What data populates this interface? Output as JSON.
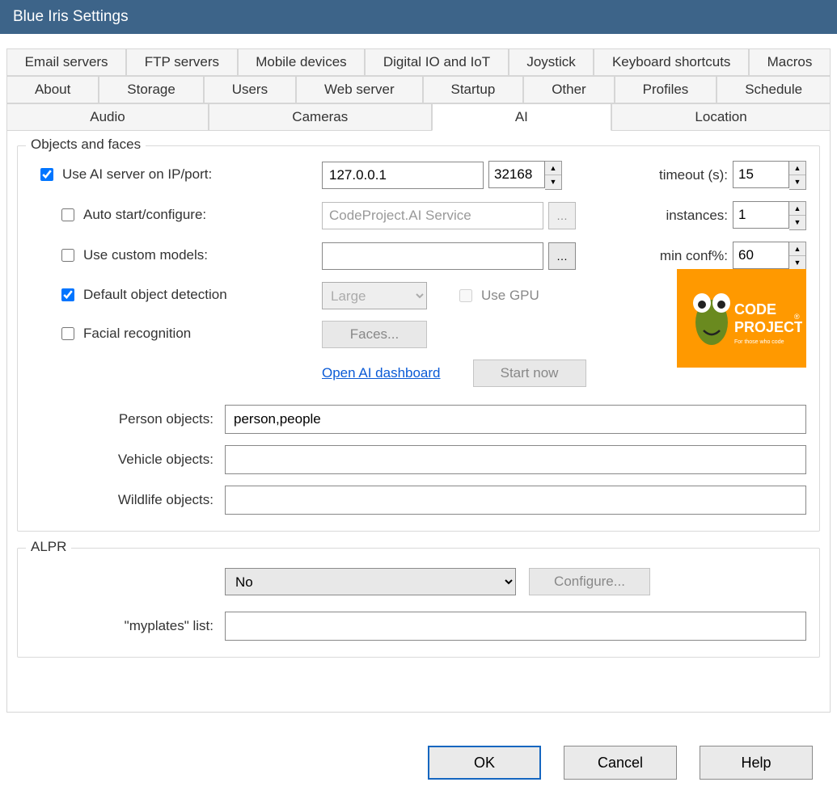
{
  "window": {
    "title": "Blue Iris Settings"
  },
  "tabs": {
    "row1": [
      "Email servers",
      "FTP servers",
      "Mobile devices",
      "Digital IO and IoT",
      "Joystick",
      "Keyboard shortcuts",
      "Macros"
    ],
    "row2": [
      "About",
      "Storage",
      "Users",
      "Web server",
      "Startup",
      "Other",
      "Profiles",
      "Schedule"
    ],
    "row3": [
      "Audio",
      "Cameras",
      "AI",
      "Location"
    ],
    "active": "AI"
  },
  "group_objects": {
    "legend": "Objects and faces",
    "use_ai_label": "Use AI server on IP/port:",
    "use_ai_checked": true,
    "ip": "127.0.0.1",
    "port": "32168",
    "timeout_label": "timeout (s):",
    "timeout": "15",
    "auto_start_label": "Auto start/configure:",
    "auto_start_checked": false,
    "service_name": "CodeProject.AI Service",
    "instances_label": "instances:",
    "instances": "1",
    "custom_models_label": "Use custom models:",
    "custom_models_checked": false,
    "custom_models_path": "",
    "min_conf_label": "min conf%:",
    "min_conf": "60",
    "default_detect_label": "Default object detection",
    "default_detect_checked": true,
    "size_options": [
      "Large"
    ],
    "size_value": "Large",
    "use_gpu_label": "Use GPU",
    "use_gpu_checked": false,
    "facial_label": "Facial recognition",
    "facial_checked": false,
    "faces_btn": "Faces...",
    "open_dashboard": "Open AI dashboard",
    "start_now": "Start now",
    "person_label": "Person objects:",
    "person_value": "person,people",
    "vehicle_label": "Vehicle objects:",
    "vehicle_value": "",
    "wildlife_label": "Wildlife objects:",
    "wildlife_value": "",
    "logo_line1": "CODE",
    "logo_line2": "PROJECT",
    "logo_tag": "For those who code"
  },
  "group_alpr": {
    "legend": "ALPR",
    "value": "No",
    "options": [
      "No"
    ],
    "configure": "Configure...",
    "myplates_label": "\"myplates\" list:",
    "myplates_value": ""
  },
  "footer": {
    "ok": "OK",
    "cancel": "Cancel",
    "help": "Help"
  }
}
